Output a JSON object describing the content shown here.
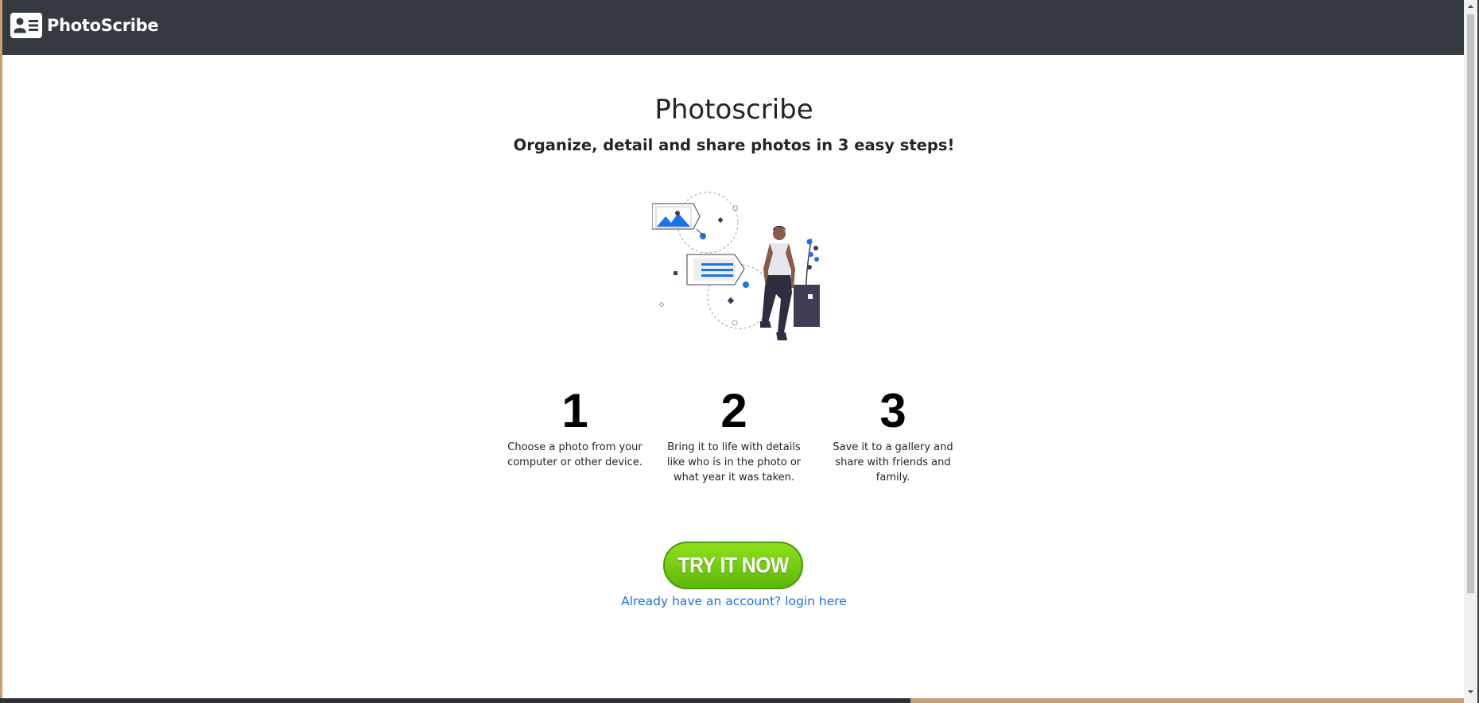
{
  "navbar": {
    "brand_name": "PhotoScribe",
    "brand_icon": "id-card-icon",
    "background": "#343a40"
  },
  "hero": {
    "title": "Photoscribe",
    "subtitle": "Organize, detail and share photos in 3 easy steps!",
    "illustration": "person-with-photo-and-text-cards-illustration"
  },
  "steps": [
    {
      "number": "1",
      "text": "Choose a photo from your computer or other device."
    },
    {
      "number": "2",
      "text": "Bring it to life with details like who is in the photo or what year it was taken."
    },
    {
      "number": "3",
      "text": "Save it to a gallery and share with friends and family."
    }
  ],
  "cta": {
    "label": "TRY IT NOW",
    "color": "#6cc80f"
  },
  "login": {
    "label": "Already have an account? login here",
    "color": "#1a73e8"
  }
}
